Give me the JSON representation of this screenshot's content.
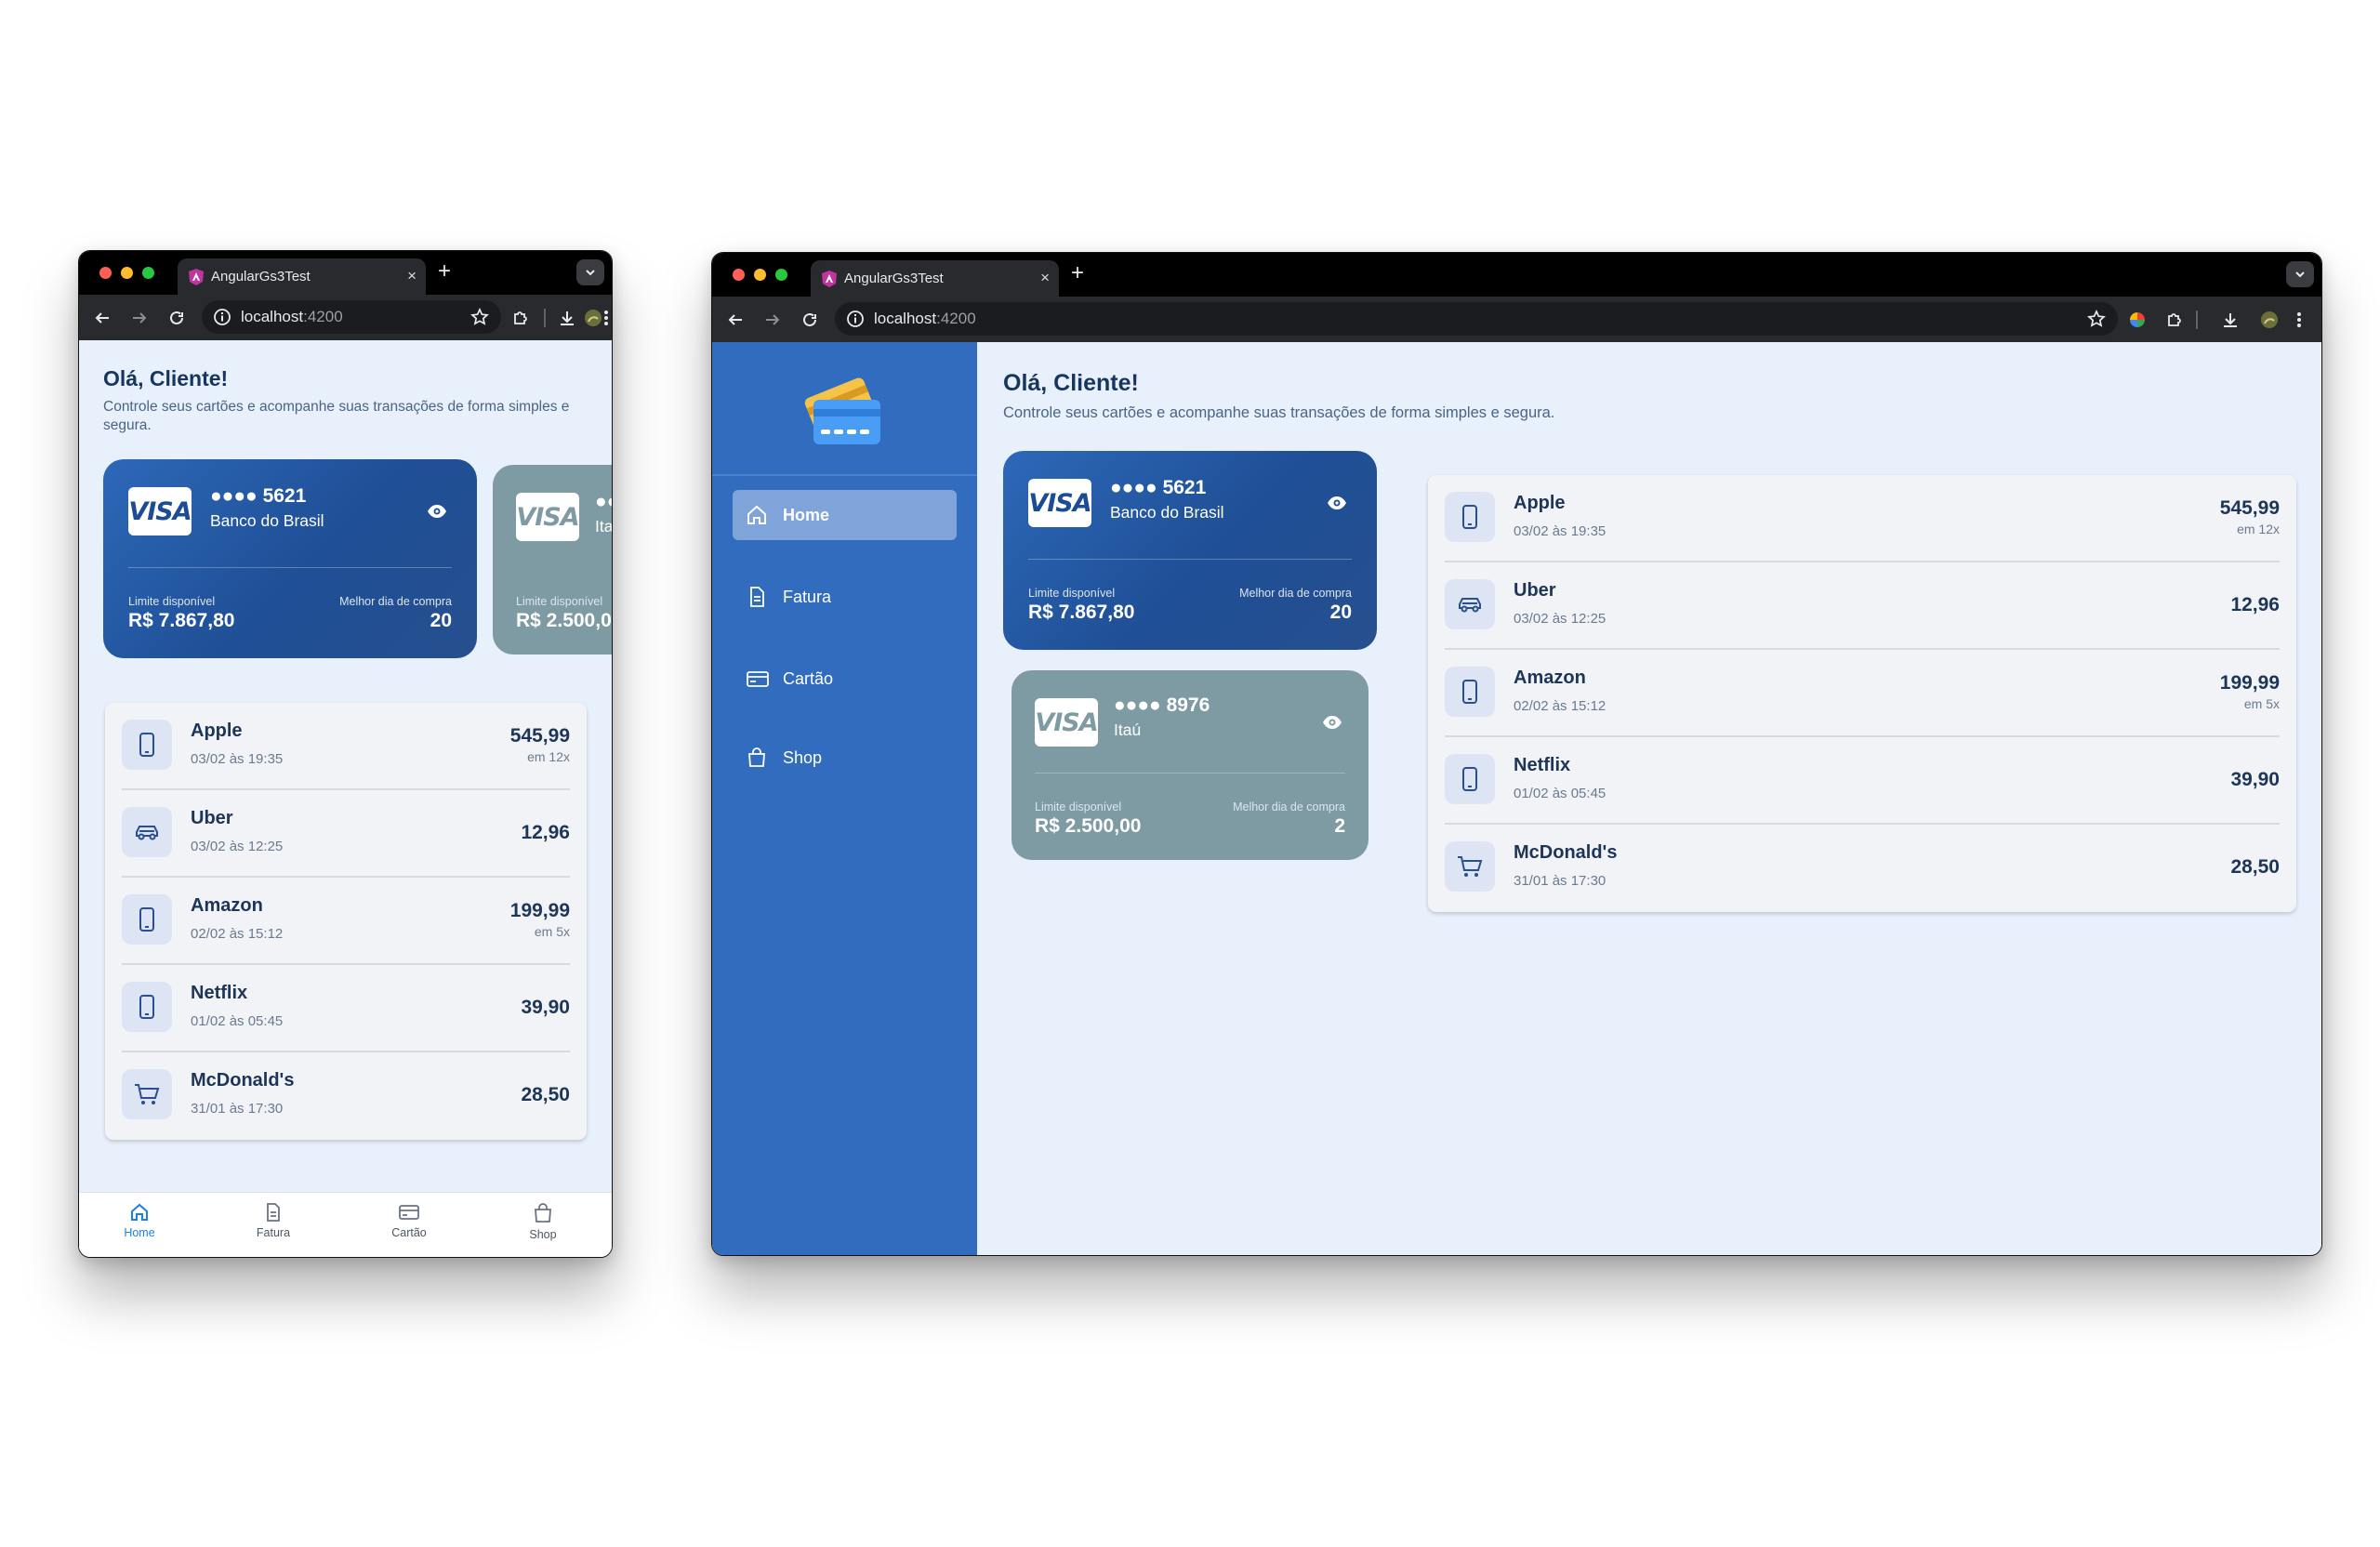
{
  "browser": {
    "tab_title": "AngularGs3Test",
    "tab_close": "×",
    "new_tab": "+",
    "url_host": "localhost",
    "url_port": ":4200"
  },
  "greeting": {
    "title": "Olá, Cliente!",
    "subtitle": "Controle seus cartões e acompanhe suas transações de forma simples e segura."
  },
  "cards": [
    {
      "brand": "VISA",
      "number": "●●●● 5621",
      "bank": "Banco do Brasil",
      "limit_label": "Limite disponível",
      "limit_value": "R$ 7.867,80",
      "best_day_label": "Melhor dia de compra",
      "best_day": "20"
    },
    {
      "brand": "VISA",
      "number": "●●●● 8976",
      "bank": "Itaú",
      "limit_label": "Limite disponível",
      "limit_value": "R$ 2.500,00",
      "best_day_label": "Melhor dia de compra",
      "best_day": "2"
    }
  ],
  "mobile_peek": {
    "number": "●●",
    "bank": "Ita",
    "limit_label": "Limite disponível",
    "limit_value": "R$ 2.500,0"
  },
  "transactions": [
    {
      "name": "Apple",
      "date": "03/02 às 19:35",
      "value": "545,99",
      "installments": "em 12x",
      "icon": "tablet-icon"
    },
    {
      "name": "Uber",
      "date": "03/02 às 12:25",
      "value": "12,96",
      "installments": "",
      "icon": "car-icon"
    },
    {
      "name": "Amazon",
      "date": "02/02 às 15:12",
      "value": "199,99",
      "installments": "em 5x",
      "icon": "tablet-icon"
    },
    {
      "name": "Netflix",
      "date": "01/02 às 05:45",
      "value": "39,90",
      "installments": "",
      "icon": "tablet-icon"
    },
    {
      "name": "McDonald's",
      "date": "31/01 às 17:30",
      "value": "28,50",
      "installments": "",
      "icon": "cart-icon"
    }
  ],
  "nav": [
    {
      "label": "Home",
      "icon": "home-icon",
      "active": true
    },
    {
      "label": "Fatura",
      "icon": "document-icon",
      "active": false
    },
    {
      "label": "Cartão",
      "icon": "credit-card-icon",
      "active": false
    },
    {
      "label": "Shop",
      "icon": "shopping-bag-icon",
      "active": false
    }
  ],
  "colors": {
    "sidebar": "#316cbe",
    "card_bb": "#1f4f96",
    "card_itau": "#7e9ba3",
    "accent": "#1d7fe0",
    "background": "#e8f0fb"
  }
}
